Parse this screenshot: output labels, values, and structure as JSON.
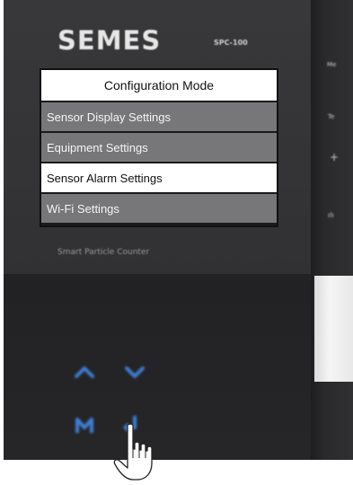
{
  "device": {
    "brand": "SEMES",
    "model": "SPC-100",
    "subtitle": "Smart Particle Counter",
    "side_labels": [
      "Me",
      "Te",
      "+",
      "ılı"
    ]
  },
  "menu": {
    "title": "Configuration Mode",
    "items": [
      {
        "label": "Sensor Display Settings",
        "state": "normal"
      },
      {
        "label": "Equipment Settings",
        "state": "normal"
      },
      {
        "label": "Sensor Alarm Settings",
        "state": "selected"
      },
      {
        "label": "Wi-Fi Settings",
        "state": "normal"
      }
    ]
  },
  "buttons": {
    "up_icon": "chevron-up-icon",
    "down_icon": "chevron-down-icon",
    "mode_icon": "M",
    "enter_icon": "enter-icon",
    "glow_color": "#3f7fd6"
  },
  "colors": {
    "menu_normal": "#777779",
    "menu_selected": "#ffffff",
    "device_body": "#333335"
  }
}
